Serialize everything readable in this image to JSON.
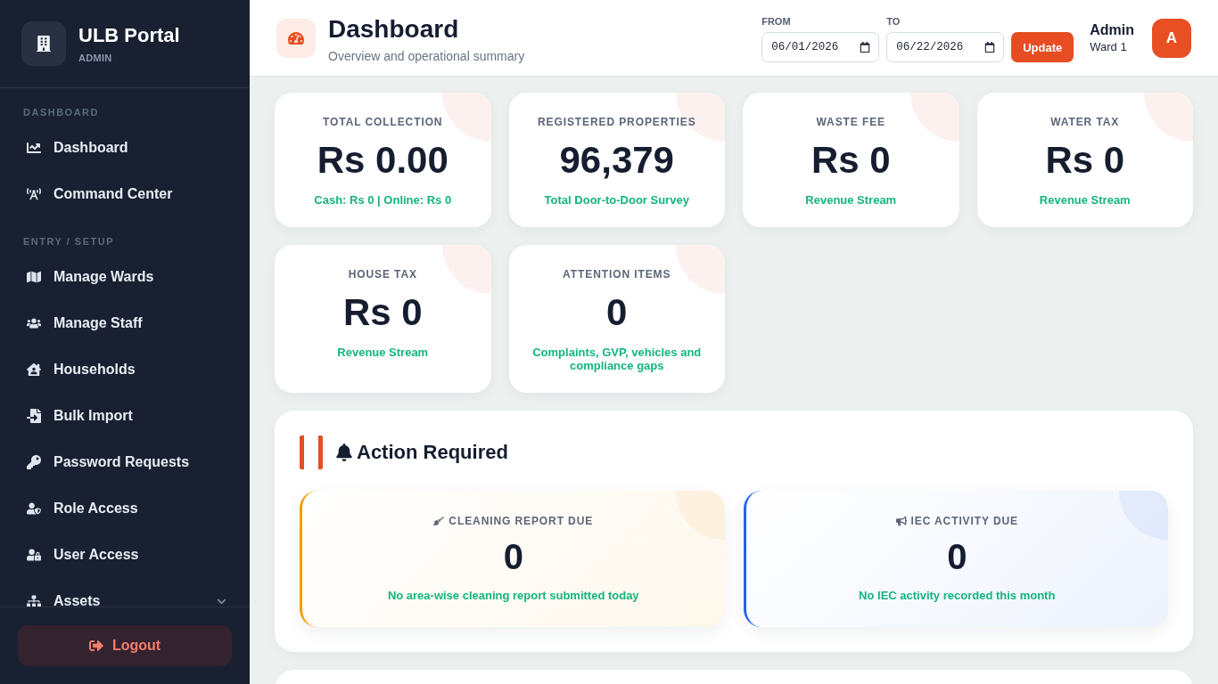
{
  "sidebar": {
    "brand": {
      "title": "ULB Portal",
      "subtitle": "ADMIN"
    },
    "sections": [
      {
        "heading": "DASHBOARD",
        "items": [
          {
            "label": "Dashboard",
            "kind": "link",
            "selected": false
          },
          {
            "label": "Command Center",
            "kind": "link",
            "selected": false
          }
        ]
      },
      {
        "heading": "ENTRY / SETUP",
        "items": [
          {
            "label": "Manage Wards",
            "kind": "link",
            "selected": false
          },
          {
            "label": "Manage Staff",
            "kind": "link",
            "selected": false
          },
          {
            "label": "Households",
            "kind": "link",
            "selected": false
          },
          {
            "label": "Bulk Import",
            "kind": "link",
            "selected": false
          },
          {
            "label": "Password Requests",
            "kind": "link",
            "selected": false
          },
          {
            "label": "Role Access",
            "kind": "link",
            "selected": false
          },
          {
            "label": "User Access",
            "kind": "link",
            "selected": false
          },
          {
            "label": "Assets",
            "kind": "group",
            "selected": false,
            "expanded": false
          }
        ]
      }
    ],
    "logout": "Logout"
  },
  "header": {
    "title": "Dashboard",
    "subtitle": "Overview and operational summary",
    "date_range": {
      "from": {
        "label": "FROM",
        "value": "06/01/2026"
      },
      "to": {
        "label": "TO",
        "value": "06/22/2026"
      }
    },
    "update_button": "Update",
    "user": {
      "name": "Admin",
      "ward": "Ward 1",
      "avatar": "A"
    }
  },
  "stat_cards": [
    {
      "label": "TOTAL COLLECTION",
      "value": "Rs 0.00",
      "note": "Cash: Rs 0 | Online: Rs 0"
    },
    {
      "label": "REGISTERED PROPERTIES",
      "value": "96,379",
      "note": "Total Door-to-Door Survey"
    },
    {
      "label": "WASTE FEE",
      "value": "Rs 0",
      "note": "Revenue Stream"
    },
    {
      "label": "WATER TAX",
      "value": "Rs 0",
      "note": "Revenue Stream"
    },
    {
      "label": "HOUSE TAX",
      "value": "Rs 0",
      "note": "Revenue Stream"
    },
    {
      "label": "ATTENTION ITEMS",
      "value": "0",
      "note": "Complaints, GVP, vehicles and compliance gaps"
    }
  ],
  "action_required": {
    "title": "Action Required",
    "cards": [
      {
        "label": "CLEANING REPORT DUE",
        "value": "0",
        "note": "No area-wise cleaning report submitted today",
        "color": "#f59e0b"
      },
      {
        "label": "IEC ACTIVITY DUE",
        "value": "0",
        "note": "No IEC activity recorded this month",
        "color": "#2563eb"
      }
    ]
  }
}
